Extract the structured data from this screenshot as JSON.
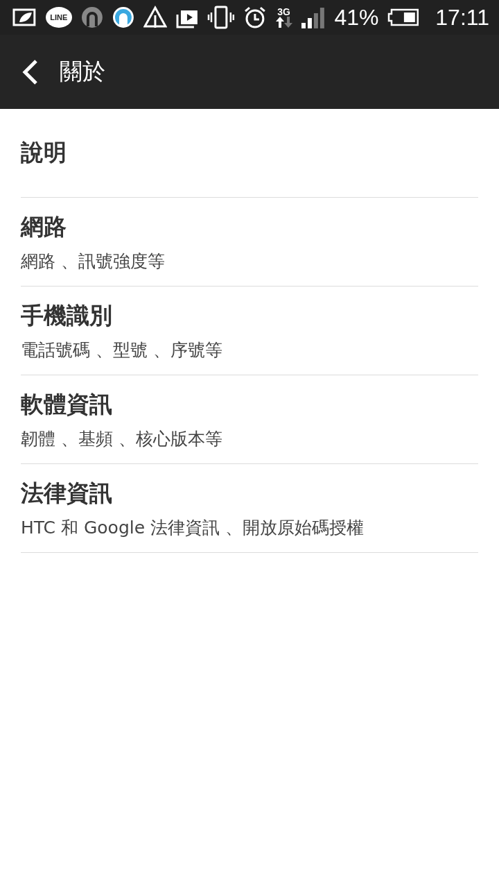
{
  "status_bar": {
    "line_label": "LINE",
    "network_type": "3G",
    "battery_percent": "41%",
    "time": "17:11"
  },
  "app_bar": {
    "title": "關於"
  },
  "items": [
    {
      "title": "說明"
    },
    {
      "title": "網路",
      "subtitle": "網路 、訊號強度等"
    },
    {
      "title": "手機識別",
      "subtitle": "電話號碼 、型號 、序號等"
    },
    {
      "title": "軟體資訊",
      "subtitle": "韌體 、基頻 、核心版本等"
    },
    {
      "title": "法律資訊",
      "subtitle": "HTC 和 Google 法律資訊 、開放原始碼授權"
    }
  ]
}
